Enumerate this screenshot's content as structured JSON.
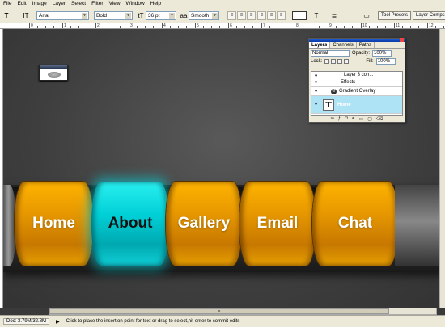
{
  "menu": [
    "File",
    "Edit",
    "Image",
    "Layer",
    "Select",
    "Filter",
    "View",
    "Window",
    "Help"
  ],
  "options": {
    "tool_icon": "T",
    "orientation_icon": "IT",
    "font_family": "Arial",
    "font_style": "Bold",
    "size_icon": "tT",
    "font_size": "36 pt",
    "aa_icon": "aa",
    "anti_alias": "Smooth",
    "warp_icon": "T",
    "palette_icon": "≣",
    "tool_presets": "Tool Presets",
    "layer_comps": "Layer Comps"
  },
  "ruler_labels": [
    "0",
    "1",
    "2",
    "3",
    "4",
    "5",
    "6",
    "7",
    "8",
    "9",
    "10",
    "11",
    "12"
  ],
  "nav": {
    "buttons": [
      "Home",
      "About",
      "Gallery",
      "Email",
      "Chat"
    ],
    "active_index": 1,
    "colors": {
      "orange": "#f0a400",
      "active": "#00d2d8"
    }
  },
  "layers_panel": {
    "tabs": [
      "Layers",
      "Channels",
      "Paths"
    ],
    "blend_mode": "Normal",
    "opacity_label": "Opacity:",
    "opacity": "100%",
    "lock_label": "Lock:",
    "fill_label": "Fill:",
    "fill": "100%",
    "items": {
      "partial": "Layer 3 con...",
      "effects": "Effects",
      "gradient": "Gradient Overlay",
      "selected": "Home"
    },
    "eye_icon": "●",
    "text_thumb": "T",
    "fx_icon": "Ø"
  },
  "status": {
    "doc": "Doc: 3.79M/32.8M",
    "arrow": "▶",
    "hint": "Click to place the insertion point for text or drag to select,hit enter to commit edits"
  },
  "scroll_grip": "≡"
}
